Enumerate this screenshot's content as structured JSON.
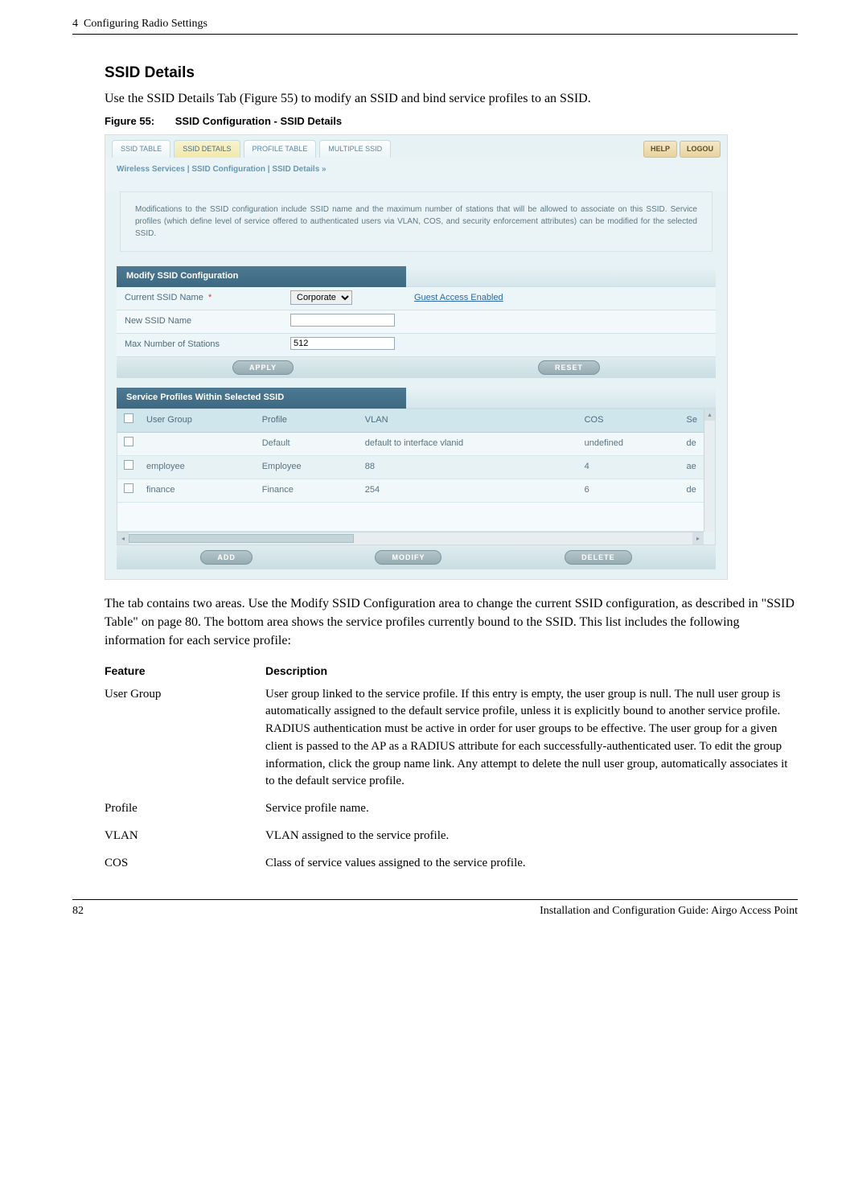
{
  "header": {
    "chapter": "4",
    "chapter_title": "Configuring Radio Settings"
  },
  "section": {
    "title": "SSID Details",
    "intro": "Use the SSID Details Tab (Figure 55) to modify an SSID and bind service profiles to an SSID.",
    "fig_num": "Figure 55:",
    "fig_title": "SSID Configuration - SSID Details"
  },
  "screenshot": {
    "tabs": [
      "SSID TABLE",
      "SSID DETAILS",
      "PROFILE TABLE",
      "MULTIPLE SSID"
    ],
    "active_tab_index": 1,
    "help": "HELP",
    "logout": "LOGOU",
    "breadcrumb": "Wireless Services | SSID Configuration | SSID Details  »",
    "description": "Modifications to the SSID configuration include SSID name and the maximum number of stations that will be allowed to associate on this SSID. Service profiles (which define level of service offered to authenticated users via VLAN, COS, and security enforcement attributes) can be modified for the selected SSID.",
    "form": {
      "panel_title": "Modify SSID Configuration",
      "fields": {
        "current_ssid_label": "Current SSID Name",
        "required_marker": "*",
        "current_ssid_value": "Corporate",
        "guest_link": "Guest Access Enabled",
        "new_ssid_label": "New SSID Name",
        "new_ssid_value": "",
        "max_stations_label": "Max Number of Stations",
        "max_stations_value": "512",
        "apply": "APPLY",
        "reset": "RESET"
      }
    },
    "profiles": {
      "panel_title": "Service Profiles Within Selected SSID",
      "headers": [
        "",
        "User Group",
        "Profile",
        "VLAN",
        "COS",
        "Se"
      ],
      "rows": [
        {
          "ug": "",
          "profile": "Default",
          "vlan": "default to interface vlanid",
          "cos": "undefined",
          "sec": "de"
        },
        {
          "ug": "employee",
          "profile": "Employee",
          "vlan": "88",
          "cos": "4",
          "sec": "ae"
        },
        {
          "ug": "finance",
          "profile": "Finance",
          "vlan": "254",
          "cos": "6",
          "sec": "de"
        }
      ],
      "add": "ADD",
      "modify": "MODIFY",
      "delete": "DELETE"
    }
  },
  "post_fig": "The tab contains two areas. Use the Modify SSID Configuration area to change the current SSID configuration, as described in \"SSID Table\" on page 80. The bottom area shows the service profiles currently bound to the SSID. This list includes the following information for each service profile:",
  "feat_table": {
    "h1": "Feature",
    "h2": "Description",
    "rows": [
      {
        "f": "User Group",
        "d": "User group linked to the service profile. If this entry is empty, the user group is null. The null user group is automatically assigned to the default service profile, unless it is explicitly bound to another service profile. RADIUS authentication must be active in order for user groups to be effective. The user group for a given client is passed to the AP as a RADIUS attribute for each successfully-authenticated user. To edit the group information, click the group name link. Any attempt to delete the null user group, automatically associates it to the default service profile."
      },
      {
        "f": "Profile",
        "d": "Service profile name."
      },
      {
        "f": "VLAN",
        "d": "VLAN assigned to the service profile."
      },
      {
        "f": "COS",
        "d": "Class of service values assigned to the service profile."
      }
    ]
  },
  "footer": {
    "page": "82",
    "title": "Installation and Configuration Guide: Airgo Access Point"
  }
}
